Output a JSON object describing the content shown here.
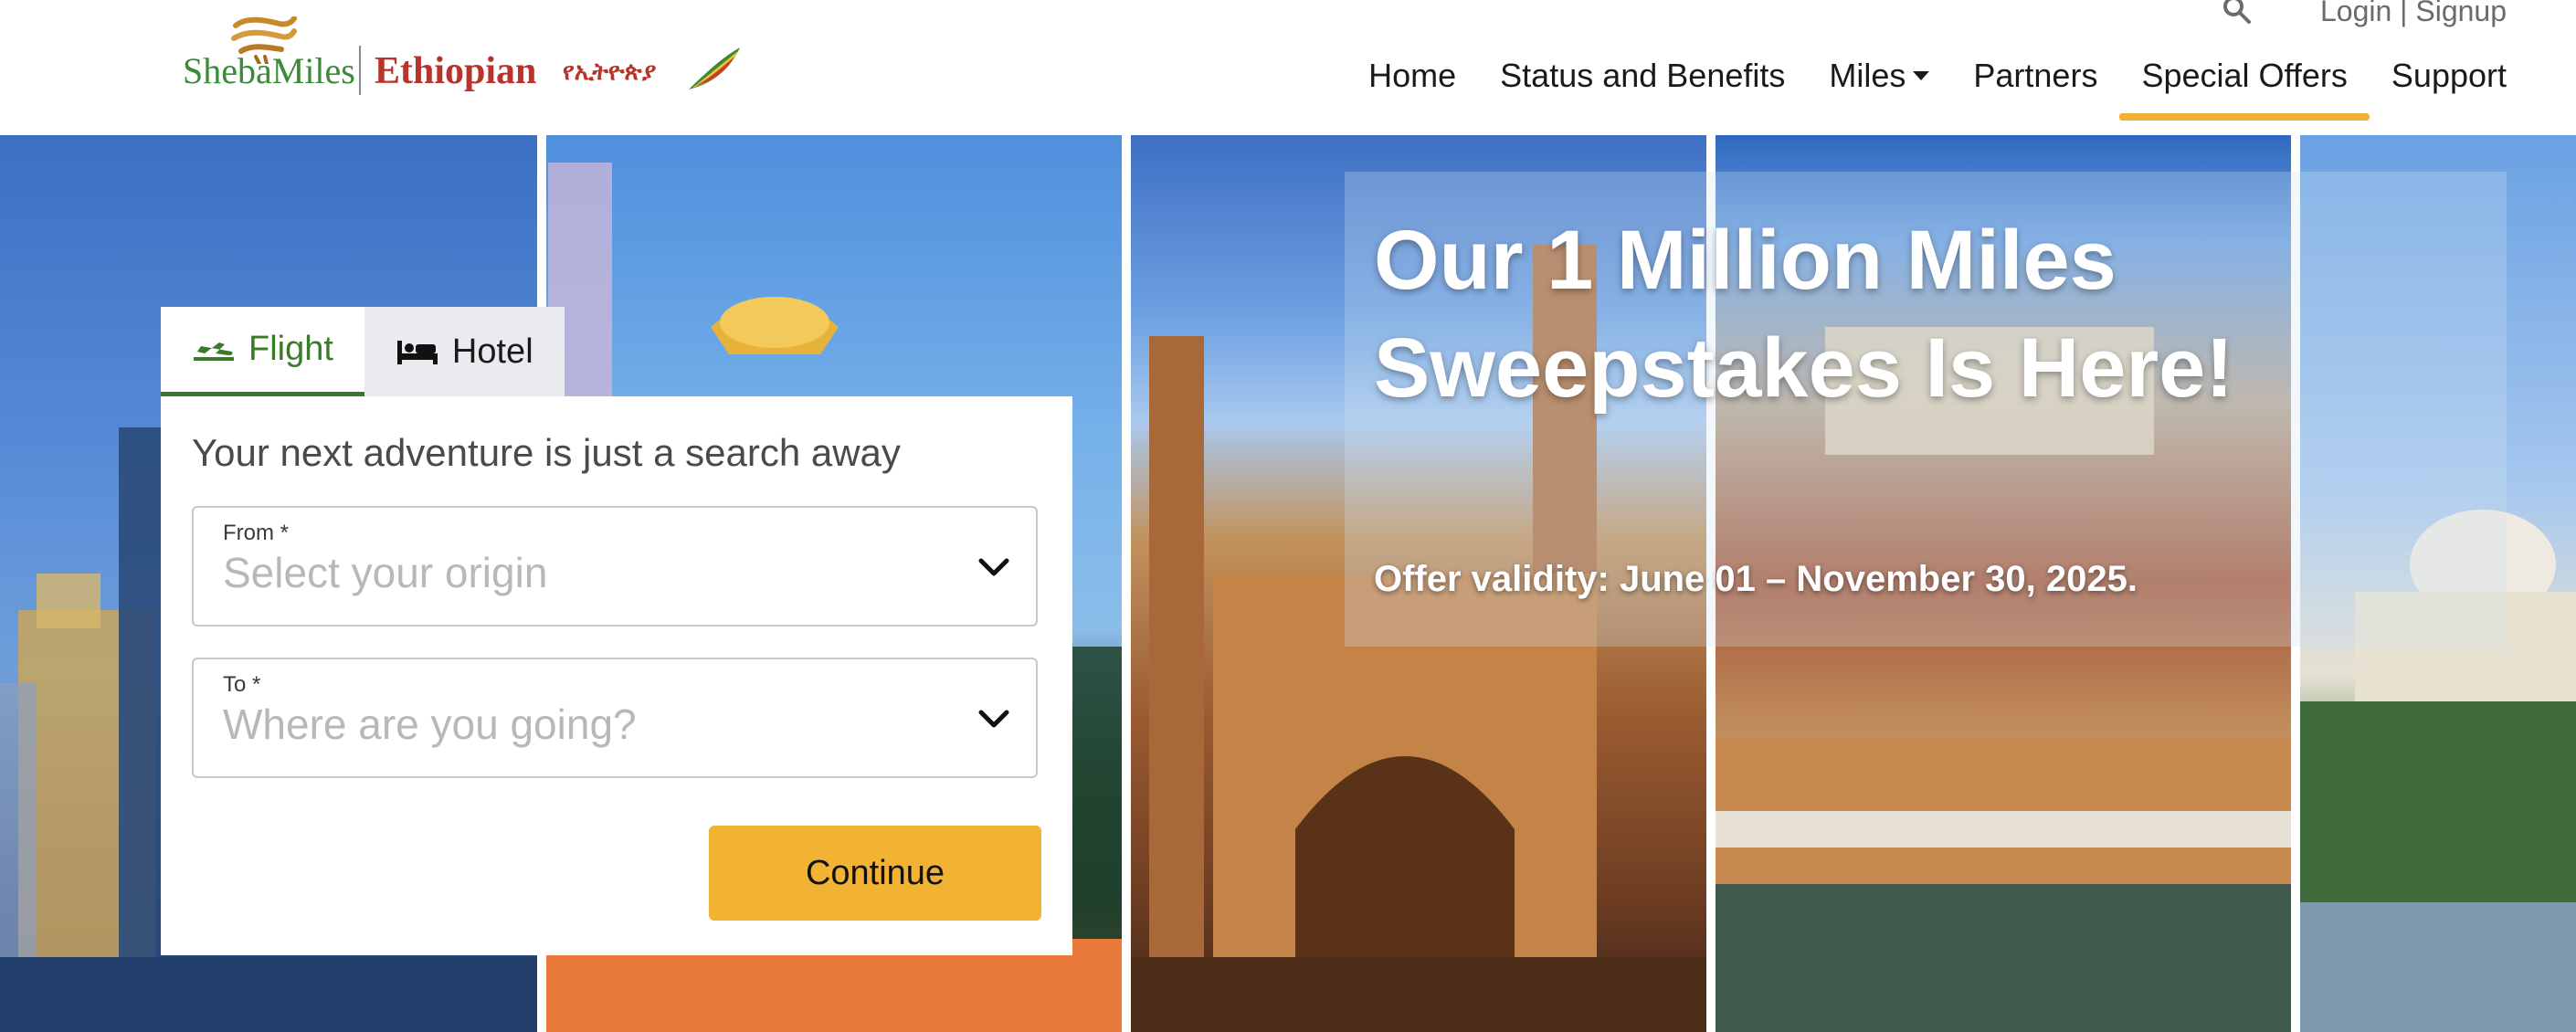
{
  "brand": {
    "program_name": "ShebaMiles",
    "airline_name": "Ethiopian",
    "airline_name_amharic": "የኢትዮጵያ"
  },
  "top_bar": {
    "login_label": "Login",
    "separator": "|",
    "signup_label": "Signup"
  },
  "nav": {
    "items": [
      {
        "label": "Home"
      },
      {
        "label": "Status and Benefits"
      },
      {
        "label": "Miles"
      },
      {
        "label": "Partners"
      },
      {
        "label": "Special Offers"
      },
      {
        "label": "Support"
      }
    ],
    "active_item": "Special Offers",
    "active_color": "#f2b233"
  },
  "search_widget": {
    "tabs": [
      {
        "label": "Flight",
        "icon": "airplane-icon"
      },
      {
        "label": "Hotel",
        "icon": "bed-icon"
      }
    ],
    "active_tab": "Flight",
    "heading": "Your next adventure is just a search away",
    "from": {
      "label": "From *",
      "placeholder": "Select your origin"
    },
    "to": {
      "label": "To *",
      "placeholder": "Where are you going?"
    },
    "continue_label": "Continue",
    "accent_color": "#3a7a2a",
    "button_color": "#f2b233"
  },
  "promo": {
    "title": "Our 1 Million Miles Sweepstakes Is Here!",
    "validity": "Offer validity: June 01 – November 30, 2025."
  }
}
